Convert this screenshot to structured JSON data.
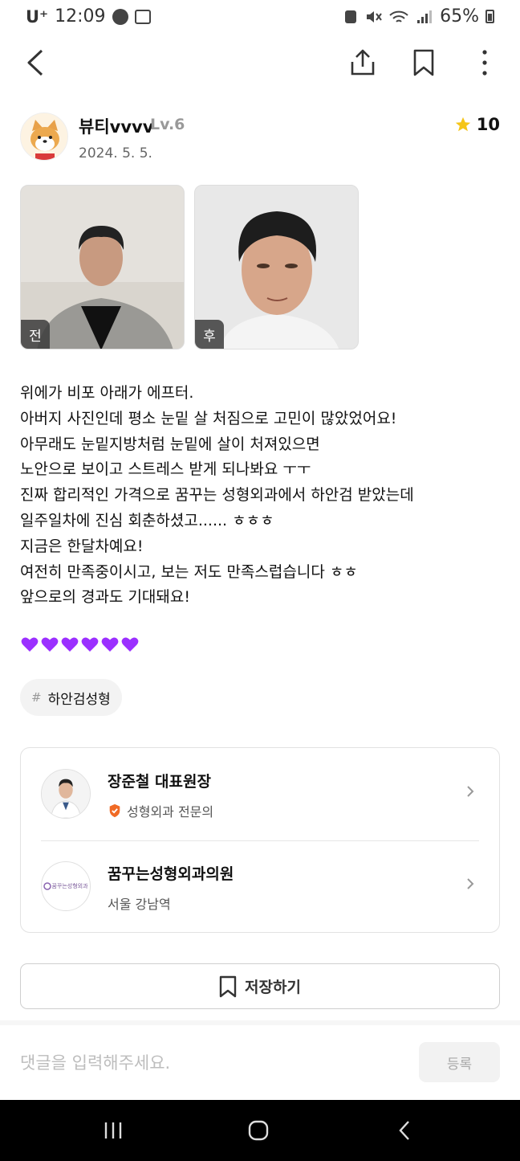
{
  "status_bar": {
    "carrier": "U⁺",
    "time": "12:09",
    "battery": "65%"
  },
  "author": {
    "name": "뷰티vvvv",
    "level": "Lv.6",
    "date": "2024. 5. 5.",
    "rating": "10"
  },
  "photos": [
    {
      "tag": "전"
    },
    {
      "tag": "후"
    }
  ],
  "body": {
    "lines": [
      "위에가 비포 아래가 에프터.",
      "아버지 사진인데 평소 눈밑 살 처짐으로 고민이 많았었어요!",
      "아무래도 눈밑지방처럼 눈밑에 살이 처져있으면",
      "노안으로 보이고 스트레스 받게 되나봐요 ㅜㅜ",
      "진짜 합리적인 가격으로 꿈꾸는 성형외과에서 하안검 받았는데",
      "일주일차에 진심 회춘하셨고...... ㅎㅎㅎ",
      "지금은 한달차예요!",
      "여전히 만족중이시고, 보는 저도 만족스럽습니다 ㅎㅎ",
      "앞으로의 경과도 기대돼요!"
    ],
    "hearts_count": 6,
    "heart_color": "#9b30ff"
  },
  "tag": {
    "hash": "#",
    "label": "하안검성형"
  },
  "doctor": {
    "name": "장준철 대표원장",
    "specialty": "성형외과 전문의"
  },
  "clinic": {
    "name": "꿈꾸는성형외과의원",
    "location": "서울 강남역",
    "logo_text": "꿈꾸는성형외과"
  },
  "save": {
    "label": "저장하기"
  },
  "comment": {
    "placeholder": "댓글을 입력해주세요.",
    "submit_label": "등록"
  },
  "colors": {
    "star": "#f5c518",
    "verified": "#f06a25"
  }
}
